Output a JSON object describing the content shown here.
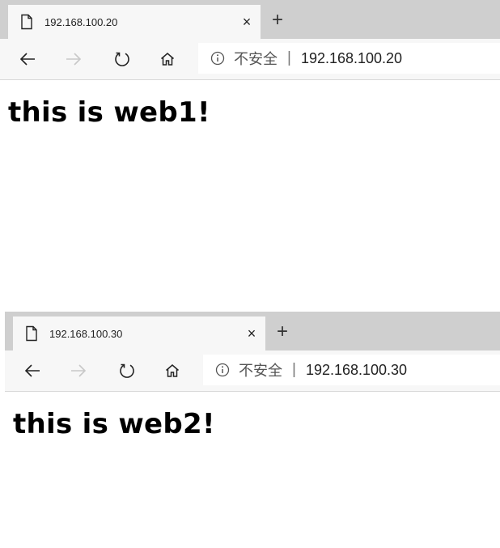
{
  "windows": [
    {
      "tab_title": "192.168.100.20",
      "tab_close": "×",
      "new_tab": "+",
      "security_label": "不安全",
      "separator": "|",
      "url": "192.168.100.20",
      "heading": "this is web1!"
    },
    {
      "tab_title": "192.168.100.30",
      "tab_close": "×",
      "new_tab": "+",
      "security_label": "不安全",
      "separator": "|",
      "url": "192.168.100.30",
      "heading": "this is web2!"
    }
  ],
  "colors": {
    "tabstrip": "#cfcfcf",
    "toolbar": "#f7f7f7",
    "forward_disabled": "#c8c8c8"
  },
  "icons": [
    "file-icon",
    "back-arrow-icon",
    "forward-arrow-icon",
    "refresh-icon",
    "home-icon",
    "info-icon"
  ]
}
